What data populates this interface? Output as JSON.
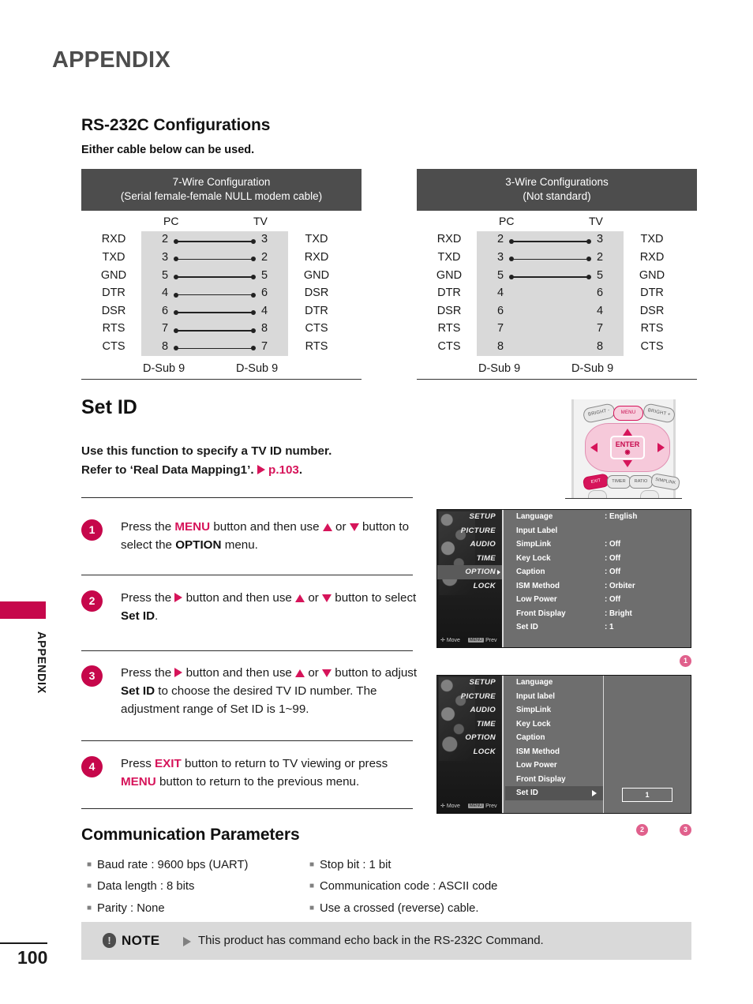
{
  "page": {
    "title": "APPENDIX",
    "side_label": "APPENDIX",
    "number": "100"
  },
  "rs232": {
    "heading": "RS-232C Configurations",
    "subheading": "Either cable below can be used.",
    "tables": [
      {
        "header_line1": "7-Wire Configuration",
        "header_line2": "(Serial female-female NULL modem cable)",
        "col_left": "PC",
        "col_right": "TV",
        "foot_left": "D-Sub 9",
        "foot_right": "D-Sub 9",
        "rows": [
          {
            "left_signal": "RXD",
            "left_pin": "2",
            "right_pin": "3",
            "right_signal": "TXD",
            "connected": true
          },
          {
            "left_signal": "TXD",
            "left_pin": "3",
            "right_pin": "2",
            "right_signal": "RXD",
            "connected": true
          },
          {
            "left_signal": "GND",
            "left_pin": "5",
            "right_pin": "5",
            "right_signal": "GND",
            "connected": true
          },
          {
            "left_signal": "DTR",
            "left_pin": "4",
            "right_pin": "6",
            "right_signal": "DSR",
            "connected": true
          },
          {
            "left_signal": "DSR",
            "left_pin": "6",
            "right_pin": "4",
            "right_signal": "DTR",
            "connected": true
          },
          {
            "left_signal": "RTS",
            "left_pin": "7",
            "right_pin": "8",
            "right_signal": "CTS",
            "connected": true
          },
          {
            "left_signal": "CTS",
            "left_pin": "8",
            "right_pin": "7",
            "right_signal": "RTS",
            "connected": true
          }
        ]
      },
      {
        "header_line1": "3-Wire Configurations",
        "header_line2": "(Not standard)",
        "col_left": "PC",
        "col_right": "TV",
        "foot_left": "D-Sub 9",
        "foot_right": "D-Sub 9",
        "rows": [
          {
            "left_signal": "RXD",
            "left_pin": "2",
            "right_pin": "3",
            "right_signal": "TXD",
            "connected": true
          },
          {
            "left_signal": "TXD",
            "left_pin": "3",
            "right_pin": "2",
            "right_signal": "RXD",
            "connected": true
          },
          {
            "left_signal": "GND",
            "left_pin": "5",
            "right_pin": "5",
            "right_signal": "GND",
            "connected": true
          },
          {
            "left_signal": "DTR",
            "left_pin": "4",
            "right_pin": "6",
            "right_signal": "DTR",
            "connected": false
          },
          {
            "left_signal": "DSR",
            "left_pin": "6",
            "right_pin": "4",
            "right_signal": "DSR",
            "connected": false
          },
          {
            "left_signal": "RTS",
            "left_pin": "7",
            "right_pin": "7",
            "right_signal": "RTS",
            "connected": false
          },
          {
            "left_signal": "CTS",
            "left_pin": "8",
            "right_pin": "8",
            "right_signal": "CTS",
            "connected": false
          }
        ]
      }
    ]
  },
  "setid": {
    "heading": "Set ID",
    "intro_line1": "Use this function to specify a TV ID number.",
    "intro_line2_a": "Refer to ‘Real Data Mapping1’.",
    "intro_line2_b": "p.103",
    "intro_line2_c": ".",
    "steps": [
      {
        "num": "1"
      },
      {
        "num": "2"
      },
      {
        "num": "3"
      },
      {
        "num": "4"
      }
    ]
  },
  "remote": {
    "buttons": {
      "bright_minus": "BRIGHT -",
      "menu": "MENU",
      "bright_plus": "BRIGHT +",
      "enter": "ENTER",
      "exit": "EXIT",
      "timer": "TIMER",
      "ratio": "RATIO",
      "simplink": "SIMPLINK"
    }
  },
  "osd1": {
    "side_items": [
      "SETUP",
      "PICTURE",
      "AUDIO",
      "TIME",
      "OPTION",
      "LOCK"
    ],
    "selected_side": "OPTION",
    "nav_move": "Move",
    "nav_prev_key": "MENU",
    "nav_prev": "Prev",
    "rows": [
      {
        "name": "Language",
        "value": ": English"
      },
      {
        "name": "Input Label",
        "value": ""
      },
      {
        "name": "SimpLink",
        "value": ": Off"
      },
      {
        "name": "Key Lock",
        "value": ": Off"
      },
      {
        "name": "Caption",
        "value": ": Off"
      },
      {
        "name": "ISM Method",
        "value": ": Orbiter"
      },
      {
        "name": "Low Power",
        "value": ": Off"
      },
      {
        "name": "Front Display",
        "value": ": Bright"
      },
      {
        "name": "Set ID",
        "value": ": 1"
      }
    ],
    "marker": "1"
  },
  "osd2": {
    "side_items": [
      "SETUP",
      "PICTURE",
      "AUDIO",
      "TIME",
      "OPTION",
      "LOCK"
    ],
    "nav_move": "Move",
    "nav_prev_key": "MENU",
    "nav_prev": "Prev",
    "rows": [
      {
        "name": "Language",
        "selected": false
      },
      {
        "name": "Input label",
        "selected": false
      },
      {
        "name": "SimpLink",
        "selected": false
      },
      {
        "name": "Key Lock",
        "selected": false
      },
      {
        "name": "Caption",
        "selected": false
      },
      {
        "name": "ISM Method",
        "selected": false
      },
      {
        "name": "Low Power",
        "selected": false
      },
      {
        "name": "Front Display",
        "selected": false
      },
      {
        "name": "Set ID",
        "selected": true
      }
    ],
    "value": "1",
    "markers": [
      "2",
      "3"
    ]
  },
  "comm": {
    "heading": "Communication Parameters",
    "left_items": [
      "Baud rate : 9600 bps (UART)",
      "Data length : 8 bits",
      "Parity : None"
    ],
    "right_items": [
      "Stop bit : 1 bit",
      "Communication code : ASCII code",
      "Use a crossed (reverse) cable."
    ]
  },
  "note": {
    "icon": "!",
    "label": "NOTE",
    "text": "This product has command echo back in the RS-232C Command."
  },
  "colors": {
    "accent": "#c6074b",
    "accent_light": "#d6145a",
    "header_bar": "#4d4d4d",
    "band": "#d9d9d9"
  }
}
